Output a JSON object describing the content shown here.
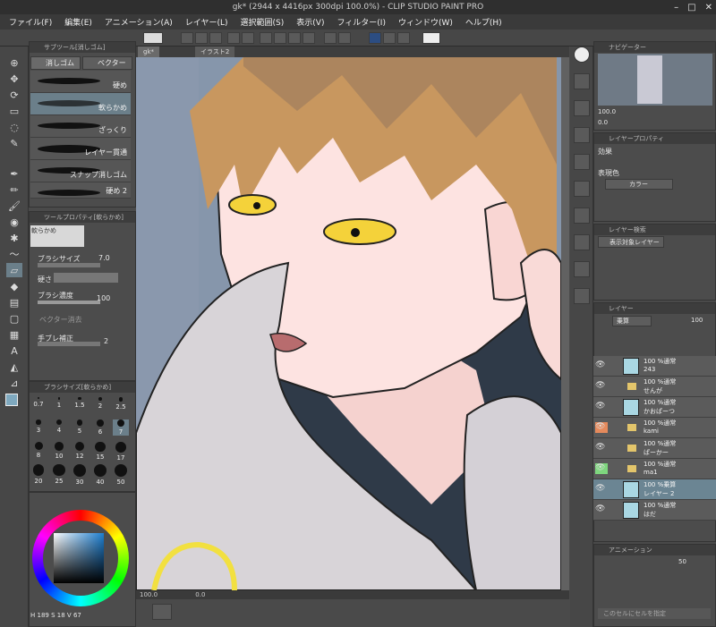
{
  "window": {
    "title": "gk* (2944 x 4416px 300dpi 100.0%)  - CLIP STUDIO PAINT PRO",
    "controls": [
      "–",
      "□",
      "✕"
    ]
  },
  "menu": [
    "ファイル(F)",
    "編集(E)",
    "アニメーション(A)",
    "レイヤー(L)",
    "選択範囲(S)",
    "表示(V)",
    "フィルター(I)",
    "ウィンドウ(W)",
    "ヘルプ(H)"
  ],
  "subtool": {
    "header": "サブツール[消しゴム]",
    "tabs": [
      "消しゴム",
      "ベクター用"
    ],
    "brushes": [
      "硬め",
      "軟らかめ",
      "ざっくり",
      "レイヤー貫通",
      "スナップ消しゴム",
      "硬め 2"
    ]
  },
  "toolprop": {
    "header": "ツールプロパティ[軟らかめ]",
    "preset": "軟らかめ",
    "size_label": "ブラシサイズ",
    "size_value": "7.0",
    "hardness_label": "硬さ",
    "density_label": "ブラシ濃度",
    "density_value": "100",
    "vector_label": "ベクター消去",
    "stabilize_label": "手ブレ補正",
    "stabilize_value": "2"
  },
  "brushsize": {
    "header": "ブラシサイズ[軟らかめ]",
    "sizes": [
      "0.7",
      "1",
      "1.5",
      "2",
      "2.5",
      "3",
      "4",
      "5",
      "6",
      "7",
      "8",
      "10",
      "12",
      "15",
      "17",
      "20",
      "25",
      "30",
      "40",
      "50"
    ]
  },
  "color": {
    "r": "189",
    "g": "18",
    "b": "67",
    "accent": "#5fa8c8"
  },
  "documents": {
    "tabs": [
      "gk*",
      "イラスト2"
    ]
  },
  "status": {
    "zoom": "100.0",
    "angle": "0.0"
  },
  "navigator": {
    "header": "ナビゲーター",
    "zoom": "100.0",
    "angle": "0.0"
  },
  "layerprop": {
    "header": "レイヤープロパティ",
    "effect_label": "効果",
    "color_label": "表現色",
    "color_value": "カラー"
  },
  "layersearch": {
    "header": "レイヤー検索",
    "filter": "表示対象レイヤー"
  },
  "layers": {
    "header": "レイヤー",
    "blend": "乗算",
    "opacity": "100",
    "items": [
      {
        "mode": "100 %通常",
        "name": "243",
        "type": "layer",
        "color": ""
      },
      {
        "mode": "100 %通常",
        "name": "せんが",
        "type": "folder",
        "color": ""
      },
      {
        "mode": "100 %通常",
        "name": "かおぱーつ",
        "type": "layer",
        "color": ""
      },
      {
        "mode": "100 %通常",
        "name": "kami",
        "type": "folder",
        "color": "#e58a5c"
      },
      {
        "mode": "100 %通常",
        "name": "ぱーかー",
        "type": "folder",
        "color": ""
      },
      {
        "mode": "100 %通常",
        "name": "ma1",
        "type": "folder",
        "color": "#7ed67e"
      },
      {
        "mode": "100 %乗算",
        "name": "レイヤー 2",
        "type": "layer",
        "color": "sel"
      },
      {
        "mode": "100 %通常",
        "name": "はだ",
        "type": "layer",
        "color": ""
      }
    ]
  },
  "anim": {
    "header": "アニメーション",
    "frame": "50",
    "cel_label": "このセルにセルを指定"
  }
}
